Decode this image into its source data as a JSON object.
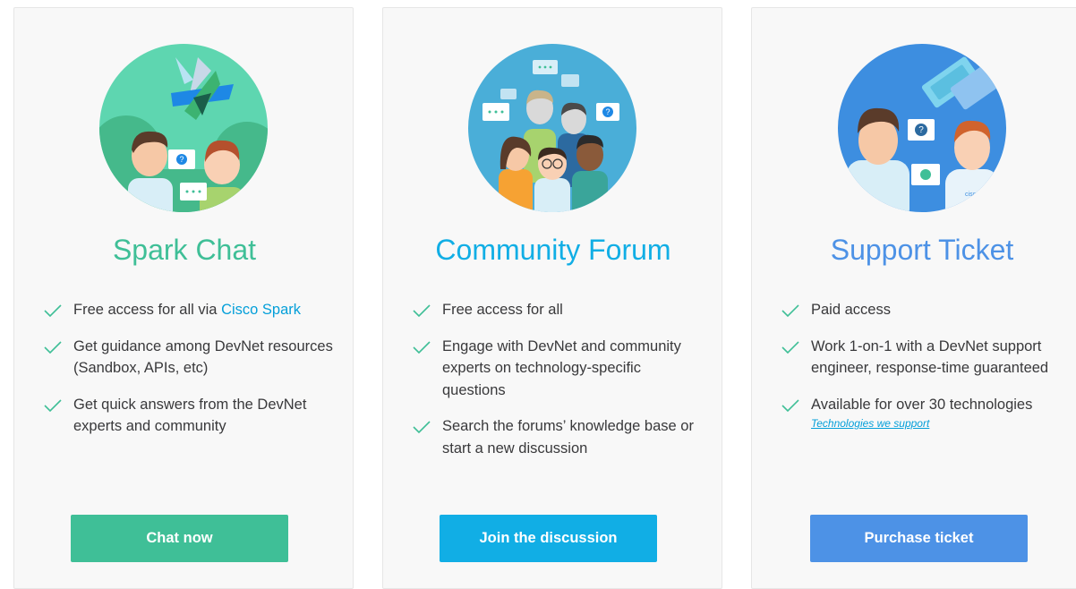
{
  "cards": [
    {
      "title": "Spark Chat",
      "title_color": "#3fbf97",
      "illustration": "two-people-chat-icon",
      "features": [
        {
          "text": "Free access for all via ",
          "link": "Cisco Spark"
        },
        {
          "text": "Get guidance among DevNet resources (Sandbox, APIs, etc)"
        },
        {
          "text": "Get quick answers from the DevNet experts and community"
        }
      ],
      "button": "Chat now",
      "button_color": "#3fbf97"
    },
    {
      "title": "Community Forum",
      "title_color": "#11aee5",
      "illustration": "community-group-icon",
      "features": [
        {
          "text": "Free access for all"
        },
        {
          "text": "Engage with DevNet and community experts on technology-specific questions"
        },
        {
          "text": "Search the forums’ knowledge base or start a new discussion"
        }
      ],
      "button": "Join the discussion",
      "button_color": "#11aee5"
    },
    {
      "title": "Support Ticket",
      "title_color": "#4d92e6",
      "illustration": "support-ticket-icon",
      "illustration_text": "cisco",
      "features": [
        {
          "text": "Paid access"
        },
        {
          "text": "Work 1-on-1 with a DevNet support engineer, response-time guaranteed"
        },
        {
          "text": "Available for over 30 technologies",
          "sublink": "Technologies we support"
        }
      ],
      "button": "Purchase ticket",
      "button_color": "#4d92e6"
    }
  ],
  "colors": {
    "check": "#3fbf97",
    "link": "#049fd9"
  }
}
